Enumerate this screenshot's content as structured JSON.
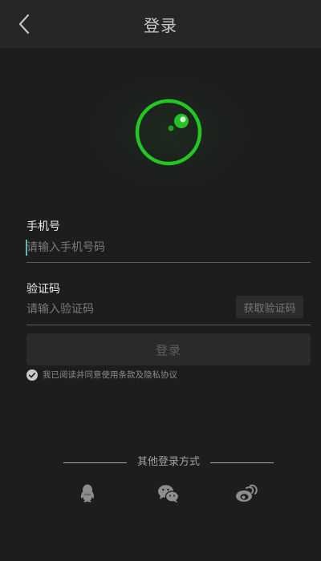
{
  "header": {
    "title": "登录",
    "back_icon": "chevron-left-icon"
  },
  "logo": {
    "icon": "logo-ring-icon",
    "accent_color": "#22c722"
  },
  "phone": {
    "label": "手机号",
    "placeholder": "请输入手机号码",
    "value": ""
  },
  "code": {
    "label": "验证码",
    "placeholder": "请输入验证码",
    "value": "",
    "get_code_label": "获取验证码"
  },
  "login_button": {
    "label": "登录"
  },
  "agreement": {
    "checked": true,
    "text": "我已阅读并同意使用条款及隐私协议"
  },
  "other_login": {
    "title": "其他登录方式",
    "providers": [
      {
        "icon": "qq-icon"
      },
      {
        "icon": "wechat-icon"
      },
      {
        "icon": "weibo-icon"
      }
    ]
  }
}
